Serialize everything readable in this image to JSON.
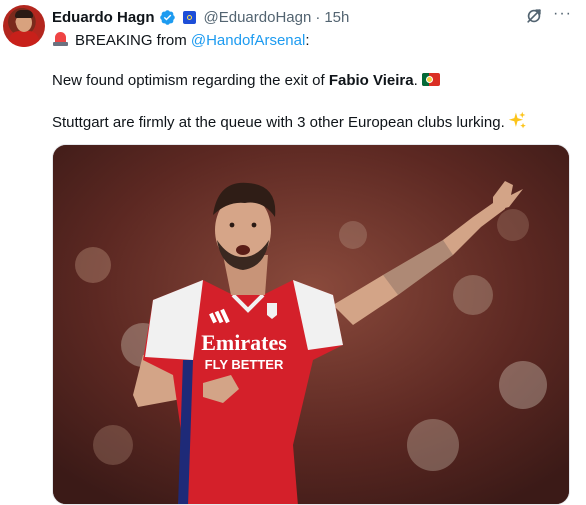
{
  "author": {
    "display_name": "Eduardo Hagn",
    "handle": "@EduardoHagn",
    "separator": "·",
    "time": "15h"
  },
  "tweet": {
    "line1_prefix": "BREAKING from",
    "line1_mention": "@HandofArsenal",
    "line1_suffix": ":",
    "line2_prefix": "New found optimism regarding the exit of",
    "line2_name": "Fabio Vieira",
    "line2_suffix": ".",
    "line3": "Stuttgart are firmly at the queue with 3 other European clubs lurking."
  },
  "media": {
    "shirt_sponsor_line1": "Emirates",
    "shirt_sponsor_line2": "FLY BETTER"
  },
  "icons": {
    "verified": "verified-badge-icon",
    "grok": "grok-icon",
    "more": "more-options-icon",
    "siren": "siren-emoji",
    "flag": "portugal-flag-emoji",
    "sparkle": "sparkles-emoji"
  },
  "colors": {
    "link": "#1d9bf0",
    "verified": "#1d9bf0",
    "secondary_text": "#536471",
    "primary_text": "#0f1419",
    "arsenal_red": "#d4202a"
  }
}
